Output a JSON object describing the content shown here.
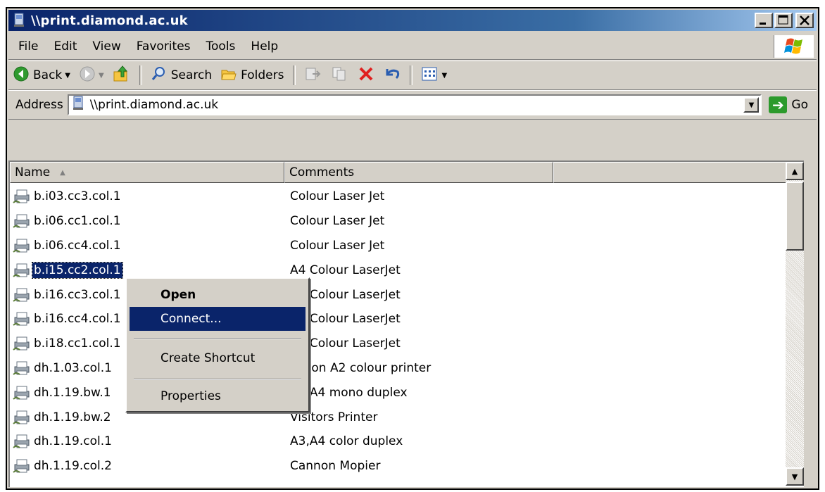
{
  "window": {
    "title": "\\\\print.diamond.ac.uk"
  },
  "menu": {
    "items": [
      "File",
      "Edit",
      "View",
      "Favorites",
      "Tools",
      "Help"
    ]
  },
  "toolbar": {
    "back_label": "Back",
    "search_label": "Search",
    "folders_label": "Folders",
    "icons": [
      "back-icon",
      "forward-icon",
      "up-folder-icon",
      "search-icon",
      "folders-icon",
      "move-to-icon",
      "copy-to-icon",
      "delete-icon",
      "undo-icon",
      "views-icon"
    ]
  },
  "address": {
    "label": "Address",
    "value": "\\\\print.diamond.ac.uk",
    "go_label": "Go"
  },
  "columns": [
    "Name",
    "Comments"
  ],
  "rows": [
    {
      "name": "b.i03.cc3.col.1",
      "comment": "Colour Laser Jet"
    },
    {
      "name": "b.i06.cc1.col.1",
      "comment": "Colour Laser Jet"
    },
    {
      "name": "b.i06.cc4.col.1",
      "comment": "Colour Laser Jet"
    },
    {
      "name": "b.i15.cc2.col.1",
      "comment": "A4 Colour LaserJet",
      "selected": true
    },
    {
      "name": "b.i16.cc3.col.1",
      "comment": "A4 Colour LaserJet"
    },
    {
      "name": "b.i16.cc4.col.1",
      "comment": "A4 Colour LaserJet"
    },
    {
      "name": "b.i18.cc1.col.1",
      "comment": "A4 Colour LaserJet"
    },
    {
      "name": "dh.1.03.col.1",
      "comment": "Epson A2 colour printer"
    },
    {
      "name": "dh.1.19.bw.1",
      "comment": "A3,A4 mono duplex"
    },
    {
      "name": "dh.1.19.bw.2",
      "comment": "Visitors Printer"
    },
    {
      "name": "dh.1.19.col.1",
      "comment": "A3,A4 color duplex"
    },
    {
      "name": "dh.1.19.col.2",
      "comment": "Cannon Mopier"
    }
  ],
  "context_menu": {
    "items": [
      {
        "label": "Open",
        "bold": true
      },
      {
        "label": "Connect...",
        "highlighted": true
      },
      {
        "label": "Create Shortcut"
      },
      {
        "label": "Properties"
      }
    ]
  },
  "colors": {
    "title_bar": "#0a246a",
    "selection": "#0a246a",
    "chrome": "#d4d0c8"
  }
}
